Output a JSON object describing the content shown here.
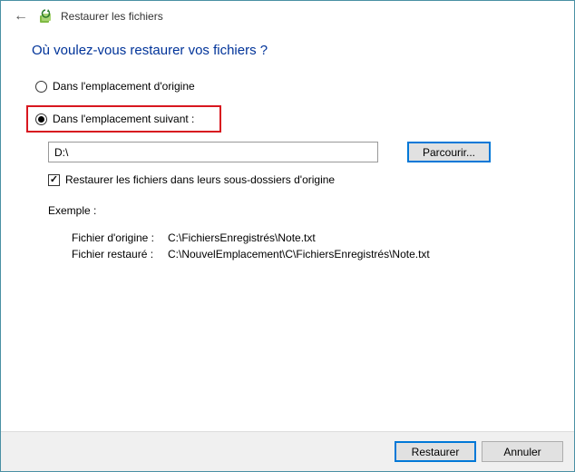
{
  "window": {
    "title": "Restaurer les fichiers"
  },
  "heading": "Où voulez-vous restaurer vos fichiers ?",
  "options": {
    "original": "Dans l'emplacement d'origine",
    "custom": "Dans l'emplacement suivant :"
  },
  "path": {
    "value": "D:\\"
  },
  "browse_label": "Parcourir...",
  "checkbox": {
    "label": "Restaurer les fichiers dans leurs sous-dossiers d'origine"
  },
  "example": {
    "title": "Exemple :",
    "original_label": "Fichier d'origine :",
    "original_path": "C:\\FichiersEnregistrés\\Note.txt",
    "restored_label": "Fichier restauré :",
    "restored_path": "C:\\NouvelEmplacement\\C\\FichiersEnregistrés\\Note.txt"
  },
  "buttons": {
    "restore": "Restaurer",
    "cancel": "Annuler"
  }
}
